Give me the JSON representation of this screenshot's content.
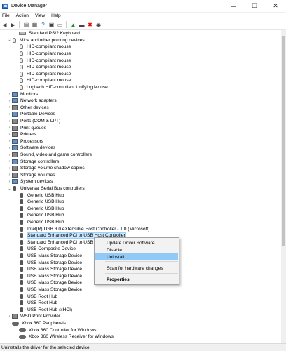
{
  "window": {
    "title": "Device Manager",
    "minimize": "─",
    "maximize": "☐",
    "close": "✕"
  },
  "menu": [
    "File",
    "Action",
    "View",
    "Help"
  ],
  "toolbar_icons": [
    "back-arrow-icon",
    "forward-arrow-icon",
    "properties-icon",
    "show-hidden-icon",
    "help-icon",
    "computer-icon",
    "monitor-icon",
    "update-driver-icon",
    "disable-device-icon",
    "uninstall-icon",
    "scan-hardware-icon"
  ],
  "tree": [
    {
      "label": "Standard PS/2 Keyboard",
      "indent": 2,
      "icon": "kbd",
      "expander": ""
    },
    {
      "label": "Mice and other pointing devices",
      "indent": 1,
      "icon": "mouse",
      "expander": "v"
    },
    {
      "label": "HID-compliant mouse",
      "indent": 2,
      "icon": "mouse",
      "expander": ""
    },
    {
      "label": "HID-compliant mouse",
      "indent": 2,
      "icon": "mouse",
      "expander": ""
    },
    {
      "label": "HID-compliant mouse",
      "indent": 2,
      "icon": "mouse",
      "expander": ""
    },
    {
      "label": "HID-compliant mouse",
      "indent": 2,
      "icon": "mouse",
      "expander": ""
    },
    {
      "label": "HID-compliant mouse",
      "indent": 2,
      "icon": "mouse",
      "expander": ""
    },
    {
      "label": "HID-compliant mouse",
      "indent": 2,
      "icon": "mouse",
      "expander": ""
    },
    {
      "label": "Logitech HID-compliant Unifying Mouse",
      "indent": 2,
      "icon": "mouse",
      "expander": ""
    },
    {
      "label": "Monitors",
      "indent": 1,
      "icon": "cat",
      "expander": ">"
    },
    {
      "label": "Network adapters",
      "indent": 1,
      "icon": "cat",
      "expander": ">"
    },
    {
      "label": "Other devices",
      "indent": 1,
      "icon": "cat2",
      "expander": ">"
    },
    {
      "label": "Portable Devices",
      "indent": 1,
      "icon": "cat",
      "expander": ">"
    },
    {
      "label": "Ports (COM & LPT)",
      "indent": 1,
      "icon": "cat2",
      "expander": ">"
    },
    {
      "label": "Print queues",
      "indent": 1,
      "icon": "cat2",
      "expander": ">"
    },
    {
      "label": "Printers",
      "indent": 1,
      "icon": "cat2",
      "expander": ">"
    },
    {
      "label": "Processors",
      "indent": 1,
      "icon": "cat",
      "expander": ">"
    },
    {
      "label": "Software devices",
      "indent": 1,
      "icon": "cat",
      "expander": ">"
    },
    {
      "label": "Sound, video and game controllers",
      "indent": 1,
      "icon": "cat2",
      "expander": ">"
    },
    {
      "label": "Storage controllers",
      "indent": 1,
      "icon": "cat",
      "expander": ">"
    },
    {
      "label": "Storage volume shadow copies",
      "indent": 1,
      "icon": "cat2",
      "expander": ">"
    },
    {
      "label": "Storage volumes",
      "indent": 1,
      "icon": "cat2",
      "expander": ">"
    },
    {
      "label": "System devices",
      "indent": 1,
      "icon": "cat",
      "expander": ">"
    },
    {
      "label": "Universal Serial Bus controllers",
      "indent": 1,
      "icon": "usb",
      "expander": "v"
    },
    {
      "label": "Generic USB Hub",
      "indent": 2,
      "icon": "usb",
      "expander": ""
    },
    {
      "label": "Generic USB Hub",
      "indent": 2,
      "icon": "usb",
      "expander": ""
    },
    {
      "label": "Generic USB Hub",
      "indent": 2,
      "icon": "usb",
      "expander": ""
    },
    {
      "label": "Generic USB Hub",
      "indent": 2,
      "icon": "usb",
      "expander": ""
    },
    {
      "label": "Generic USB Hub",
      "indent": 2,
      "icon": "usb",
      "expander": ""
    },
    {
      "label": "Intel(R) USB 3.0 eXtensible Host Controller - 1.0 (Microsoft)",
      "indent": 2,
      "icon": "usb",
      "expander": ""
    },
    {
      "label": "Standard Enhanced PCI to USB Host Controller",
      "indent": 2,
      "icon": "usb",
      "expander": "",
      "selected": true
    },
    {
      "label": "Standard Enhanced PCI to USB H",
      "indent": 2,
      "icon": "usb",
      "expander": ""
    },
    {
      "label": "USB Composite Device",
      "indent": 2,
      "icon": "usb",
      "expander": ""
    },
    {
      "label": "USB Mass Storage Device",
      "indent": 2,
      "icon": "usb",
      "expander": ""
    },
    {
      "label": "USB Mass Storage Device",
      "indent": 2,
      "icon": "usb",
      "expander": ""
    },
    {
      "label": "USB Mass Storage Device",
      "indent": 2,
      "icon": "usb",
      "expander": ""
    },
    {
      "label": "USB Mass Storage Device",
      "indent": 2,
      "icon": "usb",
      "expander": ""
    },
    {
      "label": "USB Mass Storage Device",
      "indent": 2,
      "icon": "usb",
      "expander": ""
    },
    {
      "label": "USB Mass Storage Device",
      "indent": 2,
      "icon": "usb",
      "expander": ""
    },
    {
      "label": "USB Root Hub",
      "indent": 2,
      "icon": "usb",
      "expander": ""
    },
    {
      "label": "USB Root Hub",
      "indent": 2,
      "icon": "usb",
      "expander": ""
    },
    {
      "label": "USB Root Hub (xHCI)",
      "indent": 2,
      "icon": "usb",
      "expander": ""
    },
    {
      "label": "WSD Print Provider",
      "indent": 1,
      "icon": "cat2",
      "expander": ">"
    },
    {
      "label": "Xbox 360 Peripherals",
      "indent": 1,
      "icon": "pad",
      "expander": "v"
    },
    {
      "label": "Xbox 360 Controller for Windows",
      "indent": 2,
      "icon": "pad",
      "expander": ""
    },
    {
      "label": "Xbox 360 Wireless Receiver for Windows",
      "indent": 2,
      "icon": "pad",
      "expander": ""
    }
  ],
  "context_menu": {
    "items": [
      {
        "label": "Update Driver Software...",
        "highlighted": false,
        "bold": false
      },
      {
        "label": "Disable",
        "highlighted": false,
        "bold": false
      },
      {
        "label": "Uninstall",
        "highlighted": true,
        "bold": false
      },
      {
        "label": "Scan for hardware changes",
        "highlighted": false,
        "bold": false
      },
      {
        "label": "Properties",
        "highlighted": false,
        "bold": true
      }
    ]
  },
  "status_text": "Uninstalls the driver for the selected device.",
  "colors": {
    "selection": "#cce8ff",
    "menu_highlight": "#91c9f7"
  }
}
